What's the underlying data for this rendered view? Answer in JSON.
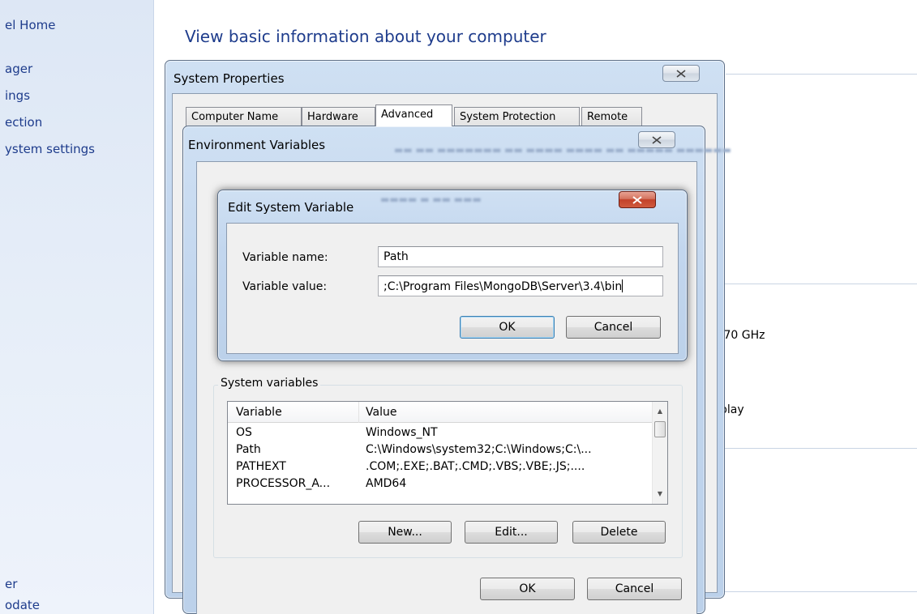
{
  "sidebar": {
    "items": [
      {
        "label": "el Home"
      },
      {
        "label": "ager"
      },
      {
        "label": "ings"
      },
      {
        "label": "ection"
      },
      {
        "label": "ystem settings"
      },
      {
        "label": "er"
      },
      {
        "label": "odate"
      }
    ]
  },
  "main": {
    "title": "View basic information about your computer",
    "fragments": {
      "cpu_speed": ".70 GHz",
      "display": "play"
    }
  },
  "system_properties": {
    "title": "System Properties",
    "tabs": [
      {
        "label": "Computer Name"
      },
      {
        "label": "Hardware"
      },
      {
        "label": "Advanced"
      },
      {
        "label": "System Protection"
      },
      {
        "label": "Remote"
      }
    ],
    "active_tab": "Advanced"
  },
  "environment_variables": {
    "title": "Environment Variables",
    "system_group_label": "System variables",
    "columns": [
      "Variable",
      "Value"
    ],
    "rows": [
      {
        "variable": "OS",
        "value": "Windows_NT"
      },
      {
        "variable": "Path",
        "value": "C:\\Windows\\system32;C:\\Windows;C:\\..."
      },
      {
        "variable": "PATHEXT",
        "value": ".COM;.EXE;.BAT;.CMD;.VBS;.VBE;.JS;...."
      },
      {
        "variable": "PROCESSOR_A...",
        "value": "AMD64"
      }
    ],
    "buttons": {
      "new": "New...",
      "edit": "Edit...",
      "delete": "Delete",
      "ok": "OK",
      "cancel": "Cancel"
    }
  },
  "edit_dialog": {
    "title": "Edit System Variable",
    "name_label": "Variable name:",
    "name_value": "Path",
    "value_label": "Variable value:",
    "value_value": ";C:\\Program Files\\MongoDB\\Server\\3.4\\bin",
    "ok": "OK",
    "cancel": "Cancel"
  },
  "colors": {
    "link": "#1e3c8c",
    "aero_frame": "#c2d6ee",
    "close_red": "#c2412a",
    "dialog_bg": "#f0f0f0"
  }
}
